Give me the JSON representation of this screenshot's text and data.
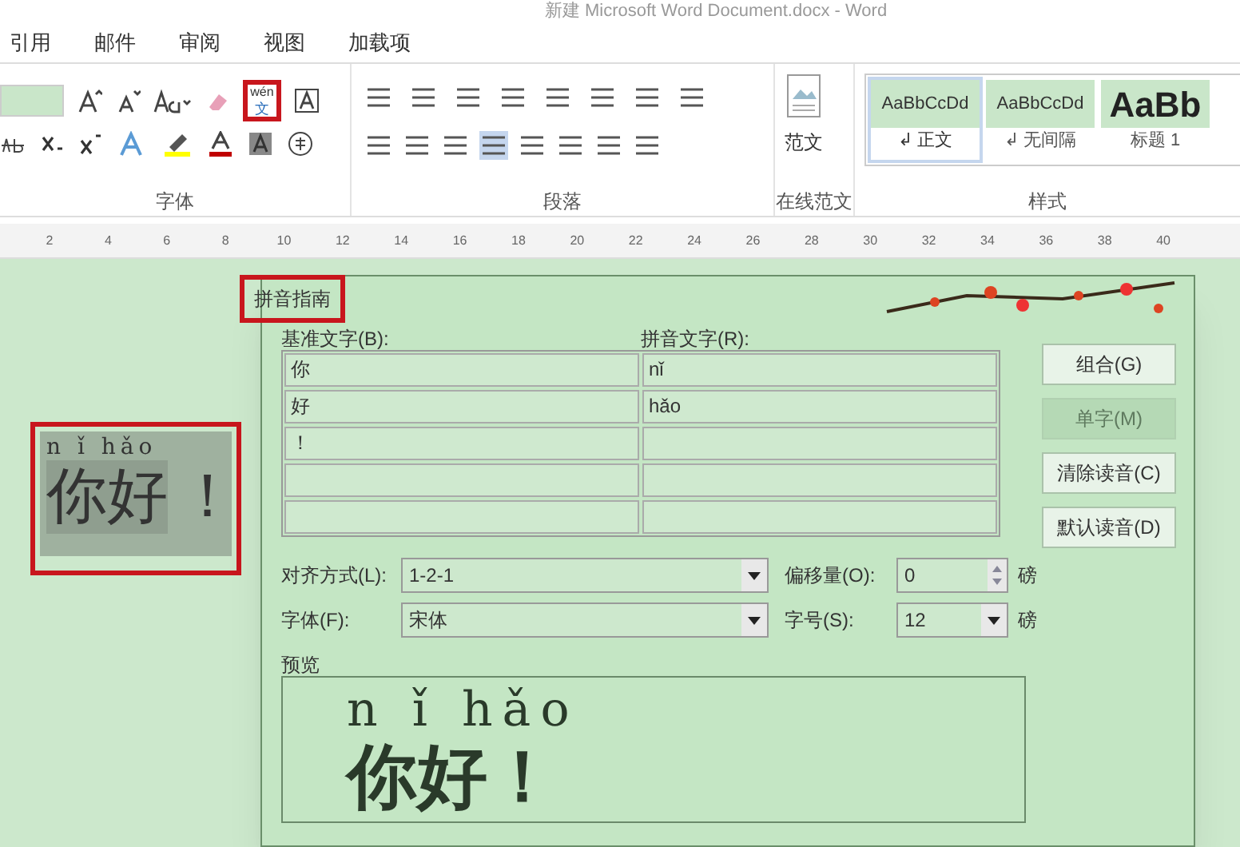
{
  "window": {
    "title": "新建 Microsoft Word Document.docx - Word"
  },
  "ribbon_tabs": [
    "引用",
    "邮件",
    "审阅",
    "视图",
    "加载项"
  ],
  "ribbon": {
    "groups": [
      {
        "label": "字体"
      },
      {
        "label": "段落"
      },
      {
        "label": "在线范文"
      },
      {
        "label": "样式"
      }
    ],
    "template_button": "范文",
    "styles": [
      {
        "sample": "AaBbCcDd",
        "label": "↲ 正文",
        "selected": true,
        "kind": "normal"
      },
      {
        "sample": "AaBbCcDd",
        "label": "↲ 无间隔",
        "selected": false,
        "kind": "normal"
      },
      {
        "sample": "AaBb",
        "label": "标题 1",
        "selected": false,
        "kind": "heading"
      }
    ],
    "phonetic_button": {
      "top": "wén",
      "bottom": "文",
      "highlighted": true
    }
  },
  "ruler": [
    "2",
    "4",
    "6",
    "8",
    "10",
    "12",
    "14",
    "16",
    "18",
    "20",
    "22",
    "24",
    "26",
    "28",
    "30",
    "32",
    "34",
    "36",
    "38",
    "40"
  ],
  "document": {
    "ruby": "n ǐ hǎo",
    "text": "你好",
    "punct": "！",
    "highlighted": true
  },
  "dialog": {
    "title": "拼音指南",
    "title_highlighted": true,
    "base_label": "基准文字(B):",
    "ruby_label": "拼音文字(R):",
    "rows": [
      {
        "base": "你",
        "ruby": "nǐ"
      },
      {
        "base": "好",
        "ruby": "hǎo"
      },
      {
        "base": "！",
        "ruby": ""
      },
      {
        "base": "",
        "ruby": ""
      },
      {
        "base": "",
        "ruby": ""
      }
    ],
    "buttons": [
      {
        "label": "组合(G)",
        "disabled": false
      },
      {
        "label": "单字(M)",
        "disabled": true
      },
      {
        "label": "清除读音(C)",
        "disabled": false
      },
      {
        "label": "默认读音(D)",
        "disabled": false
      }
    ],
    "alignment": {
      "label": "对齐方式(L):",
      "value": "1-2-1"
    },
    "offset": {
      "label": "偏移量(O):",
      "value": "0",
      "unit": "磅"
    },
    "font": {
      "label": "字体(F):",
      "value": "宋体"
    },
    "size": {
      "label": "字号(S):",
      "value": "12",
      "unit": "磅"
    },
    "preview": {
      "label": "预览",
      "ruby": "n ǐ hǎo",
      "text": "你好！"
    }
  }
}
